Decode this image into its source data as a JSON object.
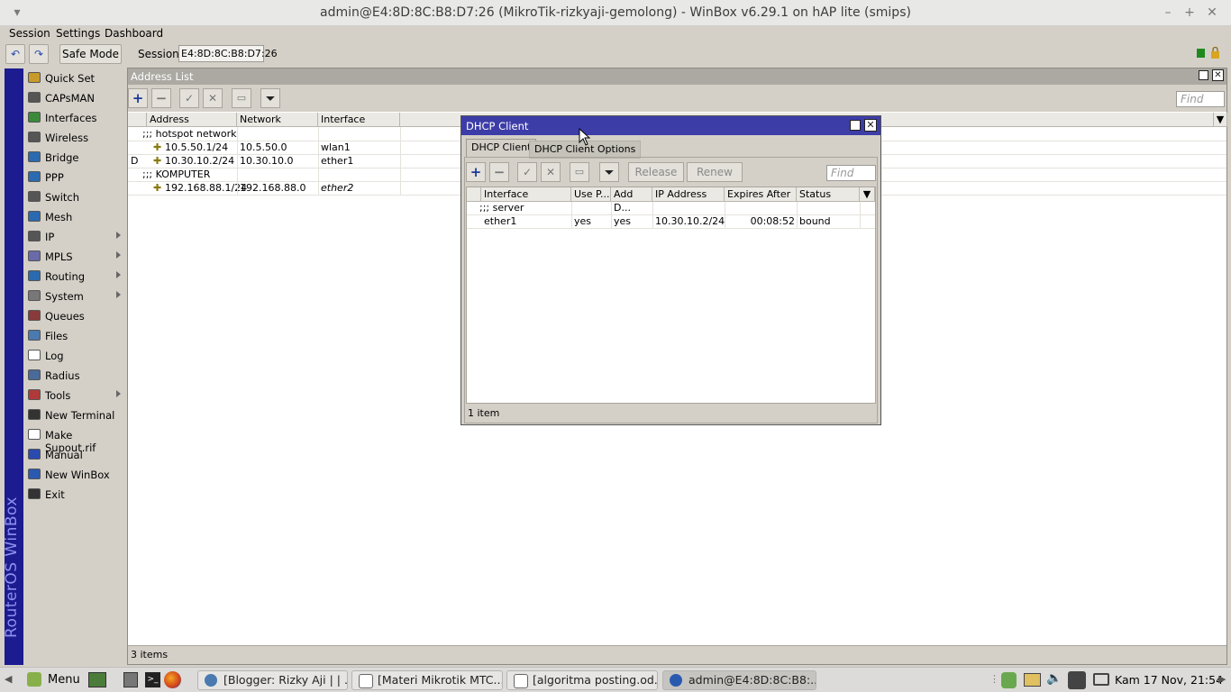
{
  "window": {
    "title": "admin@E4:8D:8C:B8:D7:26 (MikroTik-rizkyaji-gemolong) - WinBox v6.29.1 on hAP lite (smips)"
  },
  "menu": [
    "Session",
    "Settings",
    "Dashboard"
  ],
  "toolbar": {
    "safe_mode": "Safe Mode",
    "session_label": "Session:",
    "session_value": "E4:8D:8C:B8:D7:26"
  },
  "sidebar": {
    "brand": "RouterOS WinBox",
    "items": [
      {
        "label": "Quick Set",
        "icon": "quick-set-icon",
        "color": "#c79a2a",
        "submenu": false
      },
      {
        "label": "CAPsMAN",
        "icon": "capsman-icon",
        "color": "#555555",
        "submenu": false
      },
      {
        "label": "Interfaces",
        "icon": "interfaces-icon",
        "color": "#3a8a3a",
        "submenu": false
      },
      {
        "label": "Wireless",
        "icon": "wireless-icon",
        "color": "#555555",
        "submenu": false
      },
      {
        "label": "Bridge",
        "icon": "bridge-icon",
        "color": "#2a6ab0",
        "submenu": false
      },
      {
        "label": "PPP",
        "icon": "ppp-icon",
        "color": "#2a6ab0",
        "submenu": false
      },
      {
        "label": "Switch",
        "icon": "switch-icon",
        "color": "#555555",
        "submenu": false
      },
      {
        "label": "Mesh",
        "icon": "mesh-icon",
        "color": "#2a6ab0",
        "submenu": false
      },
      {
        "label": "IP",
        "icon": "ip-icon",
        "color": "#555555",
        "submenu": true
      },
      {
        "label": "MPLS",
        "icon": "mpls-icon",
        "color": "#6a6aaa",
        "submenu": true
      },
      {
        "label": "Routing",
        "icon": "routing-icon",
        "color": "#2a6ab0",
        "submenu": true
      },
      {
        "label": "System",
        "icon": "system-icon",
        "color": "#777777",
        "submenu": true
      },
      {
        "label": "Queues",
        "icon": "queues-icon",
        "color": "#8a3a3a",
        "submenu": false
      },
      {
        "label": "Files",
        "icon": "files-icon",
        "color": "#4a7ab0",
        "submenu": false
      },
      {
        "label": "Log",
        "icon": "log-icon",
        "color": "#ffffff",
        "submenu": false
      },
      {
        "label": "Radius",
        "icon": "radius-icon",
        "color": "#4a6a9a",
        "submenu": false
      },
      {
        "label": "Tools",
        "icon": "tools-icon",
        "color": "#b03a3a",
        "submenu": true
      },
      {
        "label": "New Terminal",
        "icon": "terminal-icon",
        "color": "#333333",
        "submenu": false
      },
      {
        "label": "Make Supout.rif",
        "icon": "supout-icon",
        "color": "#ffffff",
        "submenu": false
      },
      {
        "label": "Manual",
        "icon": "manual-icon",
        "color": "#2a4ab0",
        "submenu": false
      },
      {
        "label": "New WinBox",
        "icon": "winbox-icon",
        "color": "#2a5ab0",
        "submenu": false
      },
      {
        "label": "Exit",
        "icon": "exit-icon",
        "color": "#333333",
        "submenu": false
      }
    ]
  },
  "address_list": {
    "title": "Address List",
    "find_placeholder": "Find",
    "columns": [
      "Address",
      "Network",
      "Interface"
    ],
    "rows": [
      {
        "type": "comment",
        "text": ";;; hotspot network"
      },
      {
        "type": "row",
        "flag": "",
        "address": "10.5.50.1/24",
        "network": "10.5.50.0",
        "interface": "wlan1",
        "italic": false
      },
      {
        "type": "row",
        "flag": "D",
        "address": "10.30.10.2/24",
        "network": "10.30.10.0",
        "interface": "ether1",
        "italic": false
      },
      {
        "type": "comment",
        "text": ";;; KOMPUTER"
      },
      {
        "type": "row",
        "flag": "",
        "address": "192.168.88.1/24",
        "network": "192.168.88.0",
        "interface": "ether2",
        "italic": true
      }
    ],
    "status": "3 items"
  },
  "dhcp_client": {
    "title": "DHCP Client",
    "tabs": [
      "DHCP Client",
      "DHCP Client Options"
    ],
    "buttons": {
      "release": "Release",
      "renew": "Renew"
    },
    "find_placeholder": "Find",
    "columns": [
      "Interface",
      "Use P...",
      "Add D...",
      "IP Address",
      "Expires After",
      "Status"
    ],
    "comment": ";;; server",
    "rows": [
      {
        "interface": "ether1",
        "use_peer": "yes",
        "add_default": "yes",
        "ip": "10.30.10.2/24",
        "expires": "00:08:52",
        "status": "bound"
      }
    ],
    "status": "1 item"
  },
  "taskbar": {
    "menu": "Menu",
    "tasks": [
      "[Blogger: Rizky Aji | | ...",
      "[Materi Mikrotik MTC...",
      "[algoritma posting.od...",
      "admin@E4:8D:8C:B8:..."
    ],
    "clock": "Kam 17 Nov, 21:54"
  },
  "colors": {
    "sidebar_brand_bg": "#1c1b8f",
    "dialog_title_bg": "#3d3da8",
    "window_head": "#aba9a2"
  }
}
